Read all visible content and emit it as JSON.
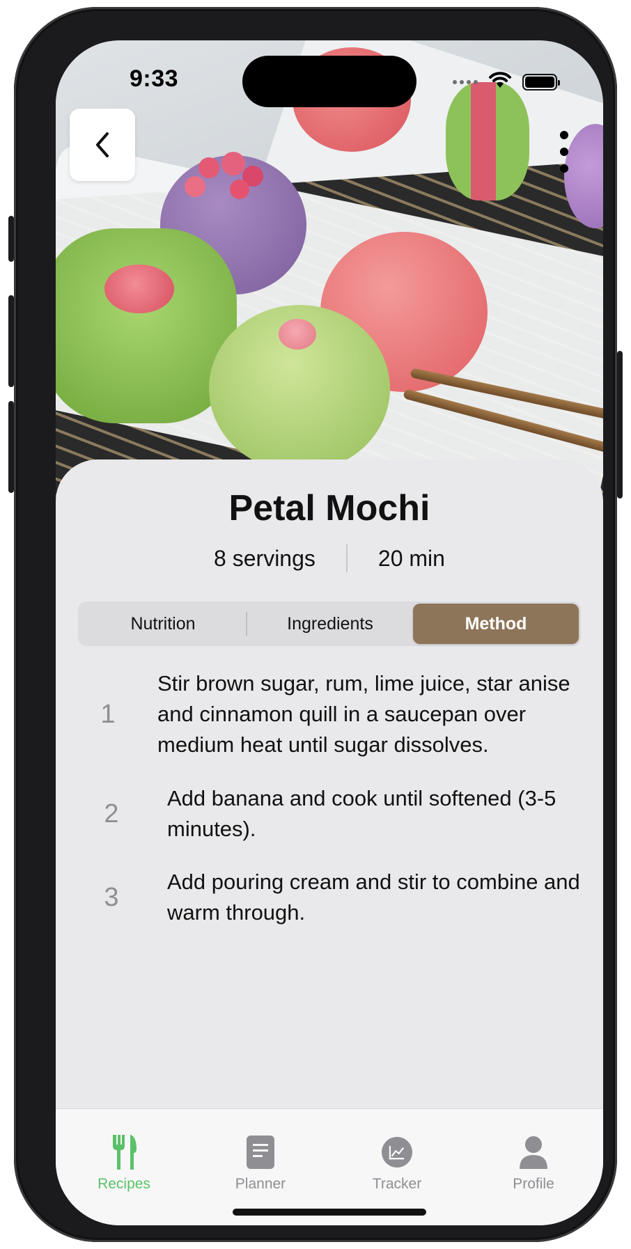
{
  "status_bar": {
    "time": "9:33"
  },
  "recipe": {
    "title": "Petal Mochi",
    "servings": "8 servings",
    "time": "20 min"
  },
  "tabs": [
    {
      "label": "Nutrition",
      "selected": false
    },
    {
      "label": "Ingredients",
      "selected": false
    },
    {
      "label": "Method",
      "selected": true
    }
  ],
  "method_steps": [
    {
      "number": "1",
      "text": "Stir brown sugar, rum, lime juice, star anise and cinnamon quill in a saucepan over medium heat until sugar dissolves."
    },
    {
      "number": "2",
      "text": "Add banana and cook until softened (3-5 minutes)."
    },
    {
      "number": "3",
      "text": "Add pouring cream and stir to combine and warm through."
    }
  ],
  "tab_bar": [
    {
      "label": "Recipes",
      "icon": "fork-knife-icon",
      "active": true
    },
    {
      "label": "Planner",
      "icon": "document-icon",
      "active": false
    },
    {
      "label": "Tracker",
      "icon": "chart-icon",
      "active": false
    },
    {
      "label": "Profile",
      "icon": "person-icon",
      "active": false
    }
  ],
  "colors": {
    "accent_segment": "#8d7559",
    "tab_active": "#5cc168",
    "tab_inactive": "#8e8e93",
    "sheet_background": "#e9e9eb"
  }
}
